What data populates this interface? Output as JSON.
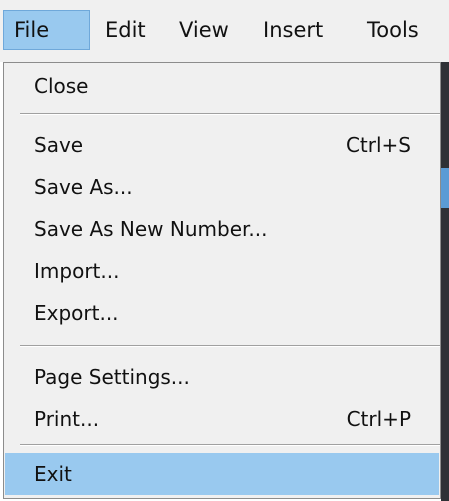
{
  "menubar": {
    "items": [
      {
        "label": "File",
        "active": true
      },
      {
        "label": "Edit",
        "active": false
      },
      {
        "label": "View",
        "active": false
      },
      {
        "label": "Insert",
        "active": false
      },
      {
        "label": "Tools",
        "active": false
      }
    ]
  },
  "file_menu": {
    "close": {
      "label": "Close"
    },
    "save": {
      "label": "Save",
      "shortcut": "Ctrl+S"
    },
    "save_as": {
      "label": "Save As..."
    },
    "save_as_new_number": {
      "label": "Save As New Number..."
    },
    "import": {
      "label": "Import..."
    },
    "export": {
      "label": "Export..."
    },
    "page_settings": {
      "label": "Page Settings..."
    },
    "print": {
      "label": "Print...",
      "shortcut": "Ctrl+P"
    },
    "exit": {
      "label": "Exit",
      "highlighted": true
    }
  },
  "colors": {
    "menu_background": "#f0f0f0",
    "highlight": "#99c9ef",
    "text": "#111111",
    "app_strip": "#2f3136",
    "app_strip_accent": "#5b9bd5"
  }
}
